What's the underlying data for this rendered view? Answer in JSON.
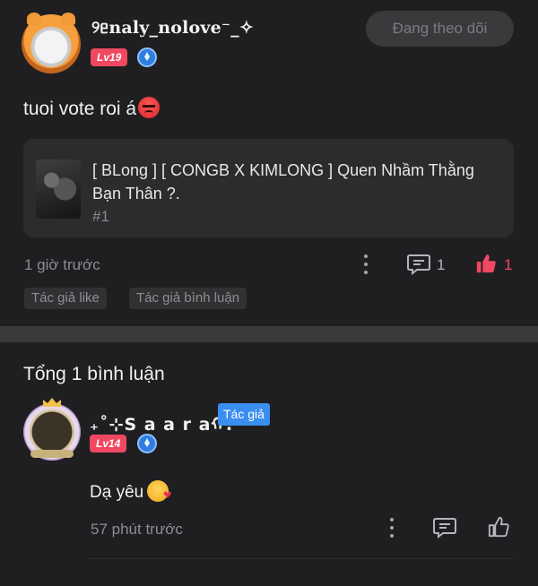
{
  "post": {
    "username": "୨ᥱnaly_nolove⁻_✧",
    "level": "Lv19",
    "follow_label": "Đang theo dõi",
    "text": "tuoi vote roi á",
    "emoji": "angry-face-emoji",
    "linked": {
      "title": "[ BLong ] [ CONGB X KIMLONG ] Quen Nhầm Thằng Bạn Thân ?.",
      "sub": "#1"
    },
    "time": "1 giờ trước",
    "comment_count": "1",
    "like_count": "1",
    "tags": [
      "Tác giả like",
      "Tác giả bình luận"
    ]
  },
  "comments": {
    "header": "Tổng 1 bình luận",
    "items": [
      {
        "username": "₊˚⊹S a a r aᡣ.",
        "author_badge": "Tác giả",
        "level": "Lv14",
        "text": "Dạ yêu",
        "emoji": "kiss-face-emoji",
        "time": "57 phút trước"
      }
    ]
  },
  "colors": {
    "background": "#1f1f21",
    "card": "#2c2c2e",
    "level_badge": "#f04861",
    "like_active": "#f04861",
    "author_badge": "#3a8ef0",
    "muted_text": "#8d8d92"
  }
}
